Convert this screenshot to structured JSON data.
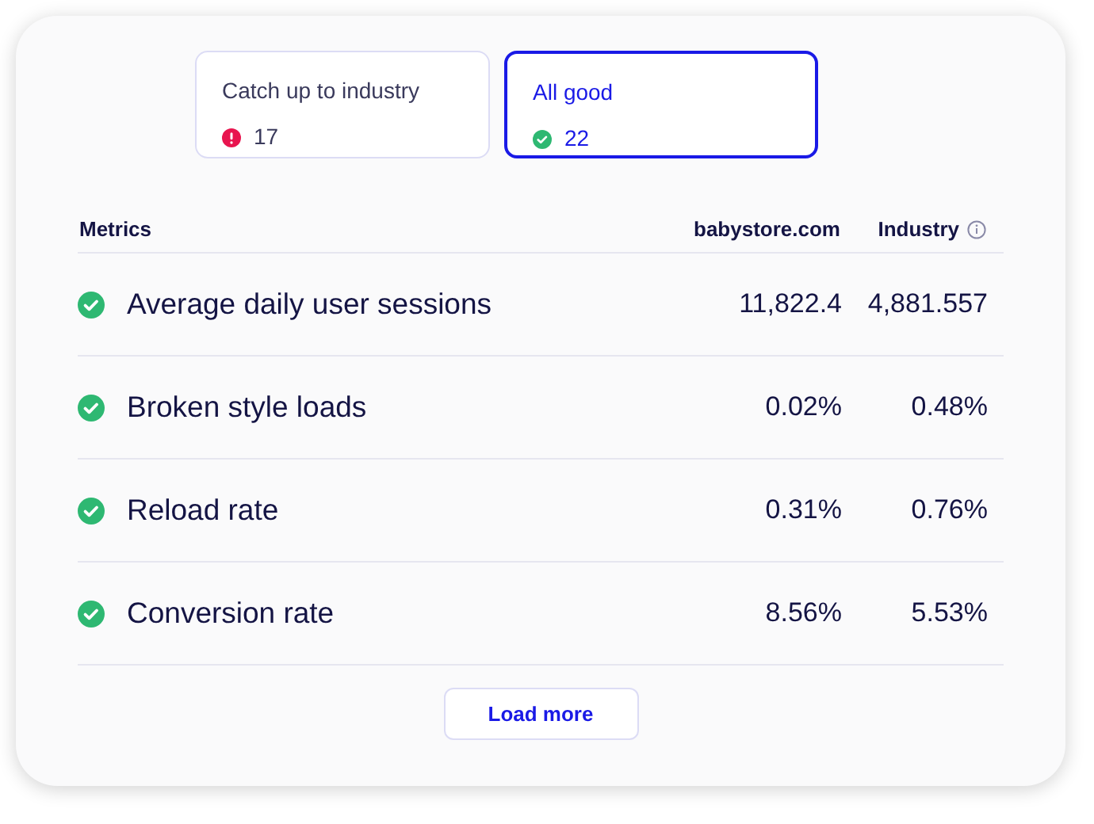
{
  "tabs": [
    {
      "label": "Catch up to industry",
      "kind": "alert",
      "count": "17",
      "selected": false
    },
    {
      "label": "All good",
      "kind": "check",
      "count": "22",
      "selected": true
    }
  ],
  "table": {
    "columns": [
      "Metrics",
      "babystore.com",
      "Industry"
    ],
    "rows": [
      {
        "kind": "check",
        "metric": "Average daily user sessions",
        "site": "11,822.4",
        "industry": "4,881.557"
      },
      {
        "kind": "check",
        "metric": "Broken style loads",
        "site": "0.02%",
        "industry": "0.48%"
      },
      {
        "kind": "check",
        "metric": "Reload rate",
        "site": "0.31%",
        "industry": "0.76%"
      },
      {
        "kind": "check",
        "metric": "Conversion rate",
        "site": "8.56%",
        "industry": "5.53%"
      }
    ]
  },
  "load_more": "Load more"
}
